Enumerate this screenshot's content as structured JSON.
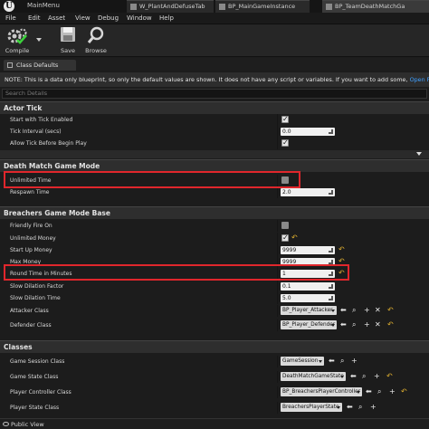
{
  "window": {
    "app_title": "MainMenu",
    "tabs": [
      "W_PlantAndDefuseTab",
      "BP_MainGameInstance",
      "BP_TeamDeathMatchGa"
    ]
  },
  "menu": [
    "File",
    "Edit",
    "Asset",
    "View",
    "Debug",
    "Window",
    "Help"
  ],
  "toolbar": {
    "compile": "Compile",
    "save": "Save",
    "browse": "Browse"
  },
  "panel": {
    "tab": "Class Defaults"
  },
  "info": {
    "text": "NOTE: This is a data only blueprint, so only the default values are shown.  It does not have any script or variables.  If you want to add some,",
    "link": "Open Full Bl"
  },
  "search": {
    "placeholder": "Search Details"
  },
  "sections": {
    "actor_tick": {
      "title": "Actor Tick",
      "rows": [
        {
          "label": "Start with Tick Enabled"
        },
        {
          "label": "Tick Interval (secs)",
          "value": "0.0"
        },
        {
          "label": "Allow Tick Before Begin Play"
        }
      ]
    },
    "death_match": {
      "title": "Death Match Game Mode",
      "rows": [
        {
          "label": "Unlimited Time"
        },
        {
          "label": "Respawn Time",
          "value": "2.0"
        }
      ]
    },
    "breachers": {
      "title": "Breachers Game Mode Base",
      "rows": [
        {
          "label": "Friendly Fire On"
        },
        {
          "label": "Unlimited Money"
        },
        {
          "label": "Start Up Money",
          "value": "9999"
        },
        {
          "label": "Max Money",
          "value": "9999"
        },
        {
          "label": "Round Time in Minutes",
          "value": "1"
        },
        {
          "label": "Slow Dilation Factor",
          "value": "0.1"
        },
        {
          "label": "Slow Dilation Time",
          "value": "5.0"
        },
        {
          "label": "Attacker Class",
          "value": "BP_Player_Attacker"
        },
        {
          "label": "Defender Class",
          "value": "BP_Player_Defender"
        }
      ]
    },
    "classes": {
      "title": "Classes",
      "rows": [
        {
          "label": "Game Session Class",
          "value": "GameSession"
        },
        {
          "label": "Game State Class",
          "value": "DeathMatchGameState"
        },
        {
          "label": "Player Controller Class",
          "value": "BP_BreachersPlayerController"
        },
        {
          "label": "Player State Class",
          "value": "BreachersPlayerState"
        }
      ]
    }
  },
  "footer": {
    "label": "Public View"
  },
  "colors": {
    "highlight": "#e0262c",
    "link": "#40a0ff",
    "reset_arrow": "#e0b030"
  }
}
